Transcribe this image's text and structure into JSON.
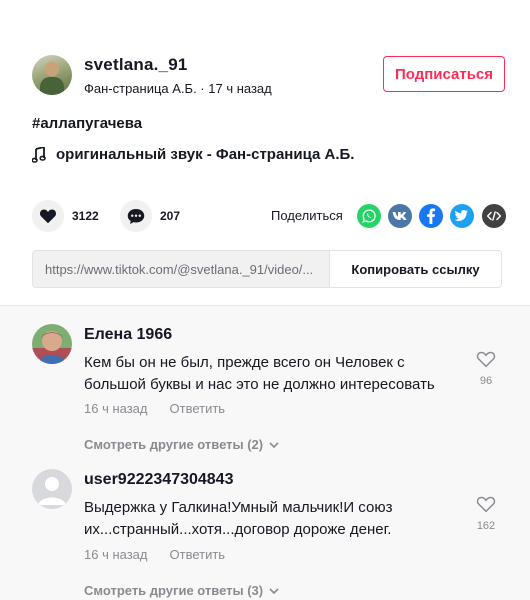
{
  "post": {
    "username": "svetlana._91",
    "subline": "Фан-страница А.Б. · 17 ч назад",
    "follow_label": "Подписаться",
    "hashtag": "#аллапугачева",
    "music": "оригинальный звук - Фан-страница А.Б."
  },
  "actions": {
    "likes": "3122",
    "comments": "207",
    "share_label": "Поделиться",
    "share_icons": [
      "whatsapp-icon",
      "vk-icon",
      "facebook-icon",
      "twitter-icon",
      "embed-icon"
    ]
  },
  "link": {
    "url": "https://www.tiktok.com/@svetlana._91/video/...",
    "copy_label": "Копировать ссылку"
  },
  "comments": [
    {
      "author": "Елена 1966",
      "text": "Кем бы он не был, прежде всего он Человек с большой буквы и нас это не должно интересовать",
      "time": "16 ч назад",
      "reply_label": "Ответить",
      "likes": "96",
      "more_replies": "Смотреть другие ответы (2)"
    },
    {
      "author": "user9222347304843",
      "text": "Выдержка у Галкина!Умный мальчик!И союз их...странный...хотя...договор дороже денег.",
      "time": "16 ч назад",
      "reply_label": "Ответить",
      "likes": "162",
      "more_replies": "Смотреть другие ответы (3)"
    }
  ],
  "colors": {
    "accent": "#fe2c55",
    "whatsapp": "#25d366",
    "vk": "#4a76a8",
    "facebook": "#1877f2",
    "twitter": "#1da1f2",
    "embed": "#414141"
  }
}
